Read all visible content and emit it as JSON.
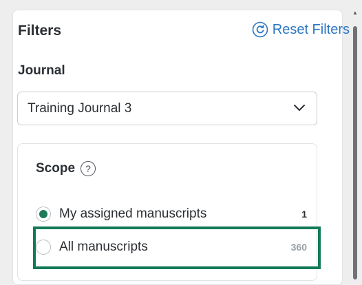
{
  "filters": {
    "title": "Filters",
    "reset_label": "Reset Filters"
  },
  "journal": {
    "label": "Journal",
    "selected": "Training Journal 3"
  },
  "scope": {
    "title": "Scope",
    "help_glyph": "?",
    "options": [
      {
        "label": "My assigned manuscripts",
        "count": "1",
        "checked": true
      },
      {
        "label": "All manuscripts",
        "count": "360",
        "checked": false
      }
    ]
  },
  "colors": {
    "accent": "#2a76c2",
    "radio_selected": "#1f7a57",
    "highlight_border": "#137a56"
  }
}
